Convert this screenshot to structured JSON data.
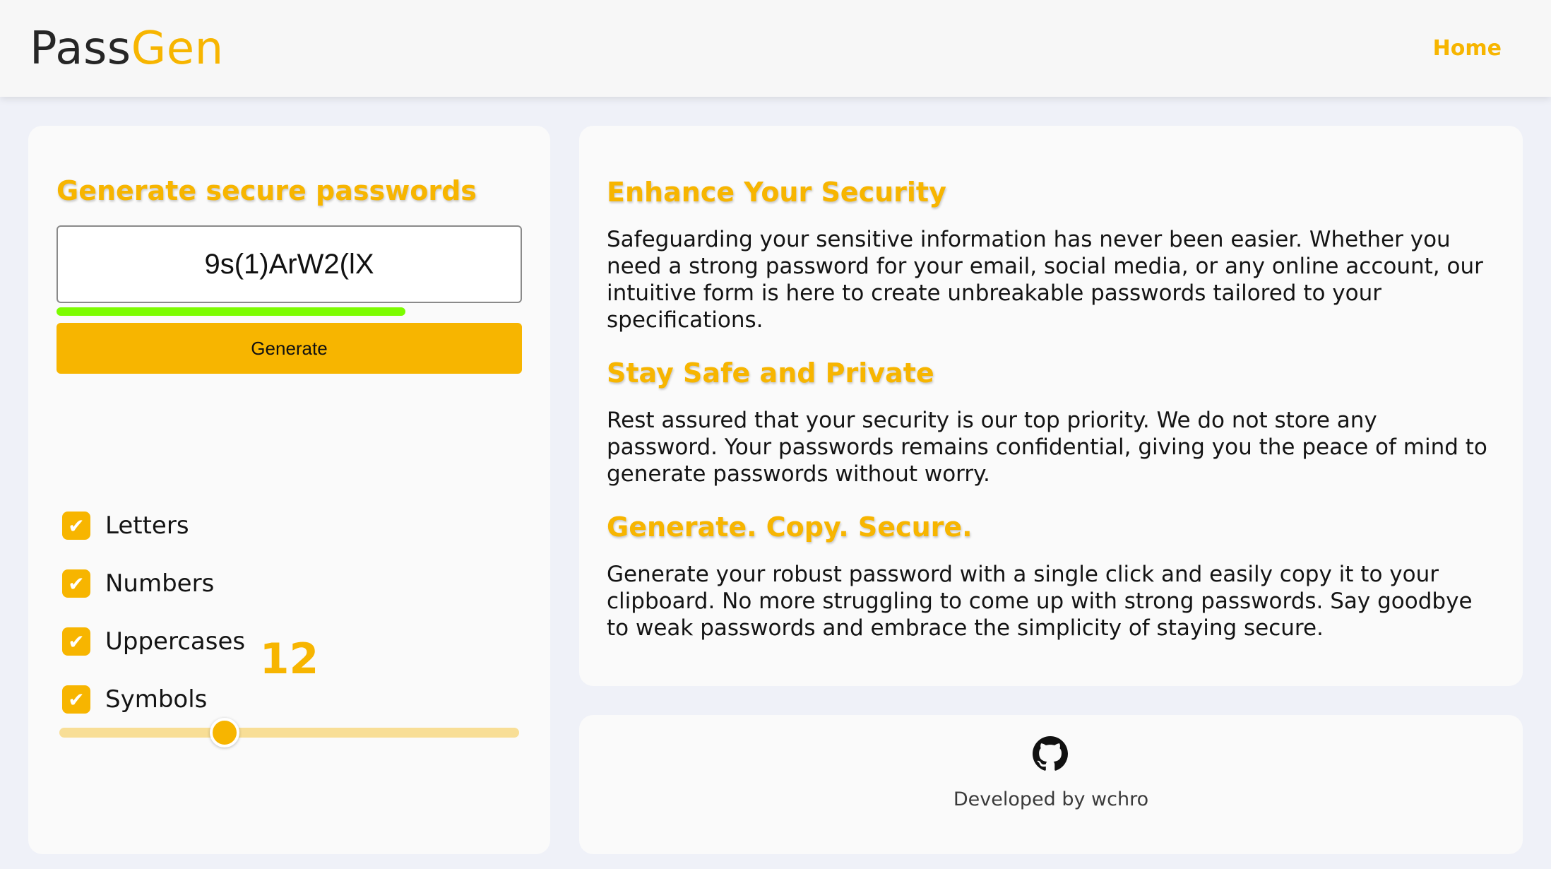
{
  "header": {
    "logo_part1": "Pass",
    "logo_part2": "Gen",
    "nav_home": "Home"
  },
  "generator": {
    "title": "Generate secure passwords",
    "password": "9s(1)ArW2(lX",
    "strength_fraction": 0.75,
    "generate_label": "Generate",
    "options": [
      {
        "label": "Letters",
        "checked": true
      },
      {
        "label": "Numbers",
        "checked": true
      },
      {
        "label": "Uppercases",
        "checked": true
      },
      {
        "label": "Symbols",
        "checked": true
      }
    ],
    "length": "12",
    "slider_fraction": 0.36
  },
  "info": {
    "sections": [
      {
        "heading": "Enhance Your Security",
        "body": "Safeguarding your sensitive information has never been easier. Whether you need a strong password for your email, social media, or any online account, our intuitive form is here to create unbreakable passwords tailored to your specifications."
      },
      {
        "heading": "Stay Safe and Private",
        "body": "Rest assured that your security is our top priority. We do not store any password. Your passwords remains confidential, giving you the peace of mind to generate passwords without worry."
      },
      {
        "heading": "Generate. Copy. Secure.",
        "body": "Generate your robust password with a single click and easily copy it to your clipboard. No more struggling to come up with strong passwords. Say goodbye to weak passwords and embrace the simplicity of staying secure."
      }
    ]
  },
  "footer": {
    "icon": "github-icon",
    "developed_by": "Developed by wchro"
  },
  "colors": {
    "accent": "#f7b500",
    "strength": "#7cfc00",
    "background": "#eff1f8"
  }
}
